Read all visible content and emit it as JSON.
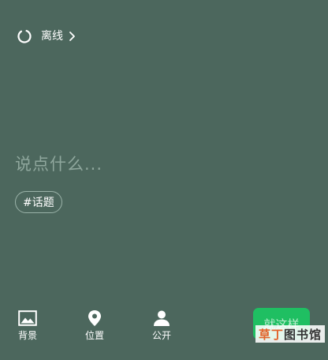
{
  "header": {
    "status_label": "离线",
    "status_icon": "loading-ring-icon",
    "chevron_icon": "chevron-right-icon"
  },
  "compose": {
    "placeholder": "说点什么..."
  },
  "topic": {
    "label": "#话题"
  },
  "toolbar": {
    "items": [
      {
        "label": "背景",
        "icon": "image-icon"
      },
      {
        "label": "位置",
        "icon": "location-pin-icon"
      },
      {
        "label": "公开",
        "icon": "person-icon"
      }
    ],
    "publish_label": "就这样"
  },
  "watermark": {
    "part1": "草丁",
    "part2": "图书馆"
  },
  "colors": {
    "background": "#4c675d",
    "accent": "#1fbf62",
    "placeholder": "#8fa79d"
  }
}
